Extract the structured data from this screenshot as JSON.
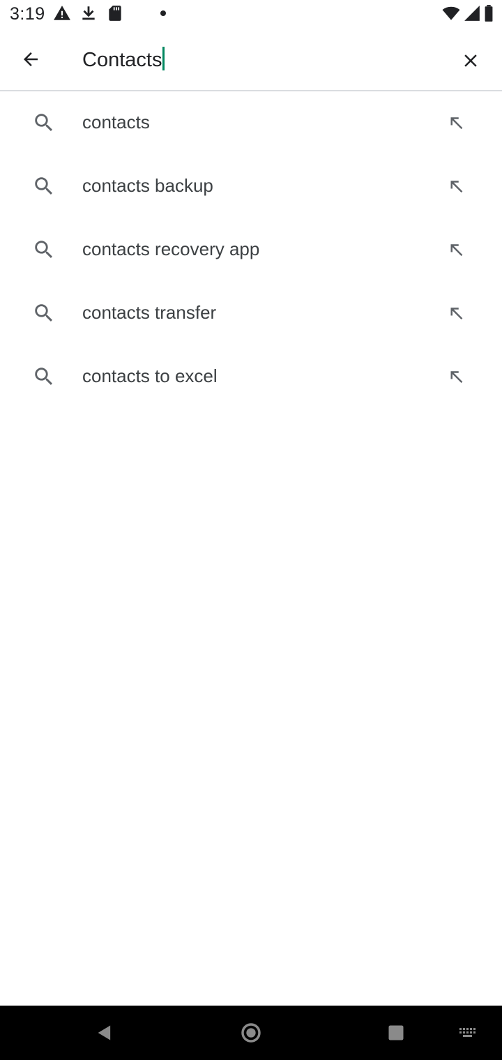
{
  "status_bar": {
    "time": "3:19",
    "icons": [
      "alert-icon",
      "download-icon",
      "sd-card-icon",
      "notification-dot-icon",
      "wifi-icon",
      "signal-icon",
      "battery-icon"
    ]
  },
  "search": {
    "query": "Contacts",
    "back_icon": "arrow-back-icon",
    "clear_icon": "close-icon"
  },
  "suggestions": [
    {
      "label": "contacts"
    },
    {
      "label": "contacts backup"
    },
    {
      "label": "contacts recovery app"
    },
    {
      "label": "contacts transfer"
    },
    {
      "label": "contacts to excel"
    }
  ],
  "nav_bar": {
    "icons": [
      "nav-back-icon",
      "nav-home-icon",
      "nav-recents-icon",
      "keyboard-icon"
    ]
  },
  "colors": {
    "accent": "#01875f",
    "text": "#202124",
    "icon": "#5f6368",
    "nav_bar": "#000000"
  }
}
